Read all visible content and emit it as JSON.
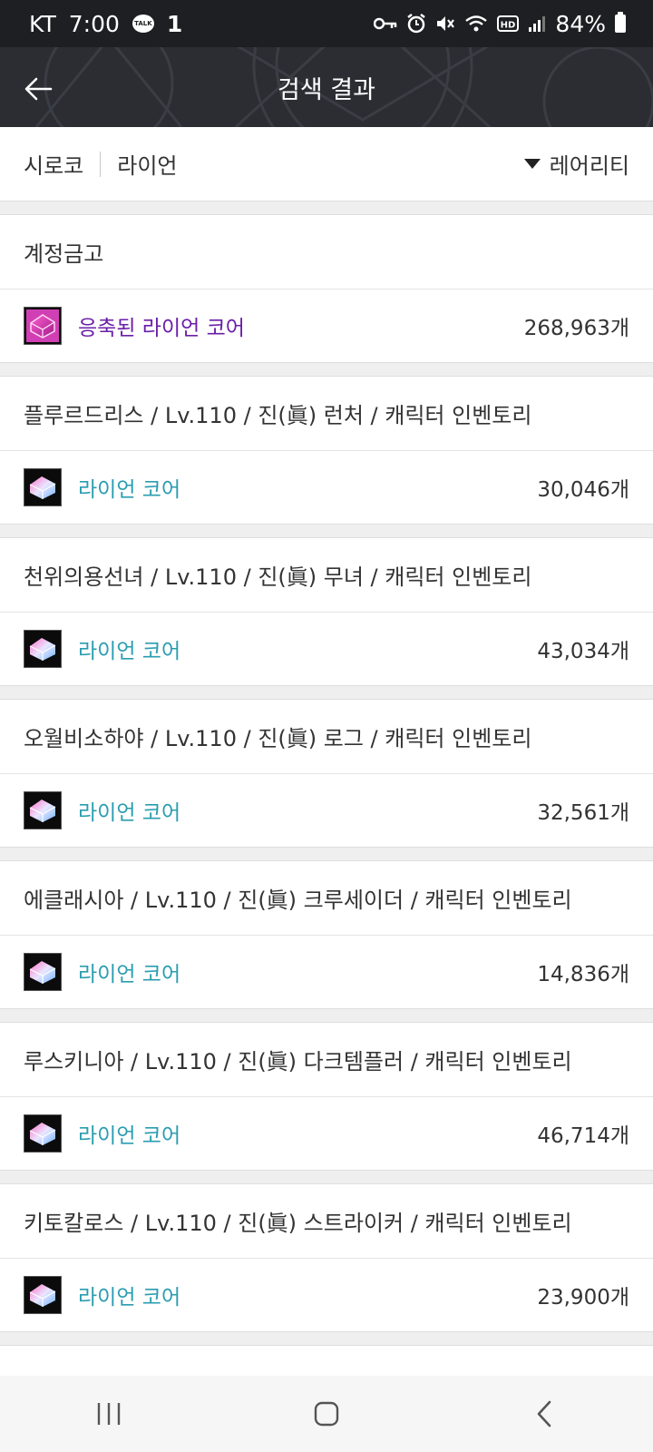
{
  "status_bar": {
    "carrier": "KT",
    "time": "7:00",
    "talk_badge": "TALK",
    "notification": "1",
    "battery": "84%",
    "icons": [
      "key-icon",
      "alarm-icon",
      "mute-icon",
      "wifi-icon",
      "hd-icon",
      "signal-icon",
      "battery-icon"
    ]
  },
  "app_bar": {
    "title": "검색 결과"
  },
  "filter": {
    "server": "시로코",
    "keyword": "라이언",
    "sort_label": "레어리티"
  },
  "colors": {
    "rare_purple": "#6a1fa8",
    "uncommon_teal": "#2a9db0"
  },
  "groups": [
    {
      "header": "계정금고",
      "item": {
        "name": "응축된 라이언 코어",
        "count": "268,963개",
        "rarity": "rare"
      }
    },
    {
      "header": "플루르드리스 / Lv.110 / 진(眞) 런처 / 캐릭터 인벤토리",
      "item": {
        "name": "라이언 코어",
        "count": "30,046개",
        "rarity": "uncommon"
      }
    },
    {
      "header": "천위의용선녀 / Lv.110 / 진(眞) 무녀 / 캐릭터 인벤토리",
      "item": {
        "name": "라이언 코어",
        "count": "43,034개",
        "rarity": "uncommon"
      }
    },
    {
      "header": "오월비소하야 / Lv.110 / 진(眞) 로그 / 캐릭터 인벤토리",
      "item": {
        "name": "라이언 코어",
        "count": "32,561개",
        "rarity": "uncommon"
      }
    },
    {
      "header": "에클래시아 / Lv.110 / 진(眞) 크루세이더 / 캐릭터 인벤토리",
      "item": {
        "name": "라이언 코어",
        "count": "14,836개",
        "rarity": "uncommon"
      }
    },
    {
      "header": "루스키니아 / Lv.110 / 진(眞) 다크템플러 / 캐릭터 인벤토리",
      "item": {
        "name": "라이언 코어",
        "count": "46,714개",
        "rarity": "uncommon"
      }
    },
    {
      "header": "키토칼로스 / Lv.110 / 진(眞) 스트라이커 / 캐릭터 인벤토리",
      "item": {
        "name": "라이언 코어",
        "count": "23,900개",
        "rarity": "uncommon"
      }
    }
  ]
}
